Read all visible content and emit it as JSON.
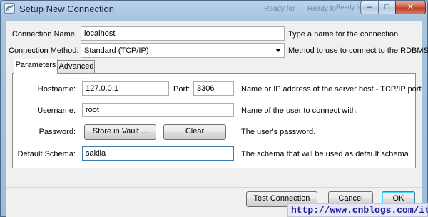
{
  "window": {
    "title": "Setup New Connection",
    "background_labels": [
      "Ready for",
      "Ready for",
      "Ready for",
      "Ready for"
    ]
  },
  "controls": {
    "minimize": "–",
    "maximize": "□",
    "close": "✕"
  },
  "form": {
    "connection_name": {
      "label": "Connection Name:",
      "value": "localhost",
      "hint": "Type a name for the connection"
    },
    "connection_method": {
      "label": "Connection Method:",
      "value": "Standard (TCP/IP)",
      "hint": "Method to use to connect to the RDBMS"
    }
  },
  "tabs": [
    {
      "label": "Parameters",
      "active": true
    },
    {
      "label": "Advanced",
      "active": false
    }
  ],
  "parameters": {
    "hostname": {
      "label": "Hostname:",
      "value": "127.0.0.1",
      "port_label": "Port:",
      "port_value": "3306",
      "hint": "Name or IP address of the server host - TCP/IP port"
    },
    "username": {
      "label": "Username:",
      "value": "root",
      "hint": "Name of the user to connect with."
    },
    "password": {
      "label": "Password:",
      "store_button": "Store in Vault ...",
      "clear_button": "Clear",
      "hint": "The user's password."
    },
    "default_schema": {
      "label": "Default Schema:",
      "value": "sakila",
      "hint": "The schema that will be used as default schema"
    }
  },
  "footer": {
    "test_button": "Test Connection",
    "cancel_button": "Cancel",
    "ok_button": "OK"
  },
  "watermark": "http://www.cnblogs.com/itech",
  "colors": {
    "title_bar": "#a9c4df",
    "client_bg": "#f0f0f0",
    "close_button": "#c9482f",
    "focus_border": "#3d7bad",
    "watermark_text": "#1a1a9a"
  },
  "icons": {
    "app": "mysql-workbench-icon",
    "dropdown": "chevron-down-icon"
  }
}
